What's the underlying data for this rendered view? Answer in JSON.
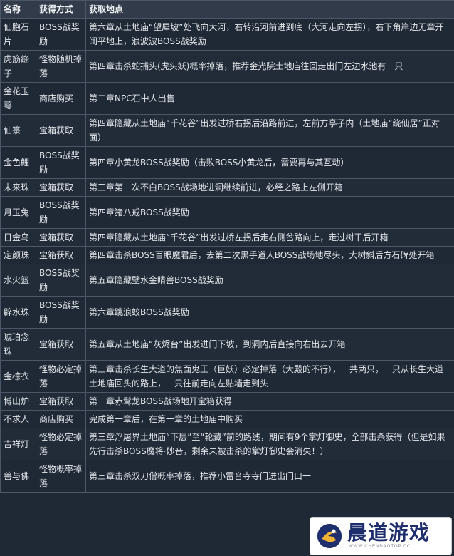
{
  "table": {
    "headers": [
      "名称",
      "获得方式",
      "获取地点"
    ],
    "rows": [
      [
        "仙胞石片",
        "BOSS战奖励",
        "第六章从土地庙“望犀坡”处飞向大河，右转沿河前进到底（大河走向左拐），右下角岸边无章开阔平地上，浪波波BOSS战奖励"
      ],
      [
        "虎筋绦子",
        "怪物随机掉落",
        "第四章击杀蛇捕头(虎头妖)概率掉落，推荐金光院土地庙往回走出门左边水池有一只"
      ],
      [
        "金花玉萼",
        "商店购买",
        "第二章NPC石中人出售"
      ],
      [
        "仙箓",
        "宝箱获取",
        "第四章隐藏从土地庙“千花谷”出发过桥右拐后沿路前进，左前方亭子内（土地庙“绕仙居”正对面）"
      ],
      [
        "金色鲤",
        "BOSS战奖励",
        "第四章小黄龙BOSS战奖励（击败BOSS小黄龙后，需要再与其互动）"
      ],
      [
        "未来珠",
        "宝箱获取",
        "第三章第一次不白BOSS战场地进洞继续前进，必经之路上左侧开箱"
      ],
      [
        "月玉兔",
        "BOSS战奖励",
        "第四章猪八戒BOSS战奖励"
      ],
      [
        "日金乌",
        "宝箱获取",
        "第四章隐藏从土地庙“千花谷”出发过桥左拐后走右侧岔路向上，走过树干后开箱"
      ],
      [
        "定颜珠",
        "宝箱获取",
        "第四章击杀BOSS百眼魔君后，去第二次黑手道人BOSS战场地尽头，大树斜后方石碑处开箱"
      ],
      [
        "水火篮",
        "BOSS战奖励",
        "第五章隐藏壁水金睛兽BOSS战奖励"
      ],
      [
        "辟水珠",
        "BOSS战奖励",
        "第六章跳浪蛟BOSS战奖励"
      ],
      [
        "琥珀念珠",
        "宝箱获取",
        "第五章从土地庙“灰烬台”出发进门下坡，到洞内后直接向右出去开箱"
      ],
      [
        "金棕衣",
        "怪物必定掉落",
        "第三章击杀长生大道的焦面鬼王（巨妖）必定掉落（大殿的不行），一共两只，一只从长生大道土地庙回头的路上，一只往前走向左贴墙走到头"
      ],
      [
        "博山炉",
        "宝箱获取",
        "第一章赤髯龙BOSS战场地开宝箱获得"
      ],
      [
        "不求人",
        "商店购买",
        "完成第一章后，在第一章的土地庙中购买"
      ],
      [
        "吉祥灯",
        "怪物必定掉落",
        "第三章浮屠界土地庙“下层”至“轮藏”前的路线，期间有9个掌灯御史，全部击杀获得（但是如果先行击杀BOSS魔将·妙音，剩余未被击杀的掌灯御史会消失！）"
      ],
      [
        "兽与佛",
        "怪物概率掉落",
        "第三章击杀双刀僧概率掉落，推荐小雷音寺寺门进出门口一"
      ]
    ]
  },
  "watermark": {
    "name": "晨道游戏",
    "url": "WWW.CHENDAOTOP.CC"
  },
  "colors": {
    "background": "#1f2835",
    "header_bg": "#313b49",
    "border": "#4c5666",
    "text": "#e3e6ea",
    "watermark_text": "#1f2f6e"
  }
}
